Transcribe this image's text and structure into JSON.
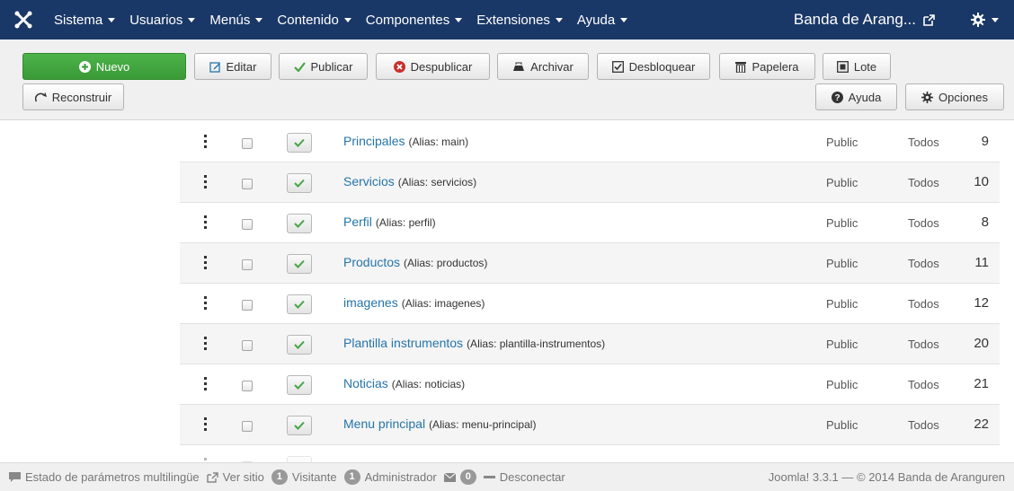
{
  "nav": {
    "menu": [
      {
        "label": "Sistema"
      },
      {
        "label": "Usuarios"
      },
      {
        "label": "Menús"
      },
      {
        "label": "Contenido"
      },
      {
        "label": "Componentes"
      },
      {
        "label": "Extensiones"
      },
      {
        "label": "Ayuda"
      }
    ],
    "site_link": "Banda de Arang...",
    "icons": {
      "logo": "joomla-logo-icon",
      "external": "external-link-icon",
      "gear": "gear-icon"
    }
  },
  "toolbar": {
    "nuevo": "Nuevo",
    "editar": "Editar",
    "publicar": "Publicar",
    "despublicar": "Despublicar",
    "archivar": "Archivar",
    "desbloquear": "Desbloquear",
    "papelera": "Papelera",
    "lote": "Lote",
    "reconstruir": "Reconstruir",
    "ayuda": "Ayuda",
    "opciones": "Opciones"
  },
  "rows": [
    {
      "title": "Principales",
      "alias": "(Alias: main)",
      "access": "Public",
      "language": "Todos",
      "id": "9"
    },
    {
      "title": "Servicios",
      "alias": "(Alias: servicios)",
      "access": "Public",
      "language": "Todos",
      "id": "10"
    },
    {
      "title": "Perfil",
      "alias": "(Alias: perfil)",
      "access": "Public",
      "language": "Todos",
      "id": "8"
    },
    {
      "title": "Productos",
      "alias": "(Alias: productos)",
      "access": "Public",
      "language": "Todos",
      "id": "11"
    },
    {
      "title": "imagenes",
      "alias": "(Alias: imagenes)",
      "access": "Public",
      "language": "Todos",
      "id": "12"
    },
    {
      "title": "Plantilla instrumentos",
      "alias": "(Alias: plantilla-instrumentos)",
      "access": "Public",
      "language": "Todos",
      "id": "20"
    },
    {
      "title": "Noticias",
      "alias": "(Alias: noticias)",
      "access": "Public",
      "language": "Todos",
      "id": "21"
    },
    {
      "title": "Menu principal",
      "alias": "(Alias: menu-principal)",
      "access": "Public",
      "language": "Todos",
      "id": "22"
    }
  ],
  "status": {
    "multilang": "Estado de parámetros multilingüe",
    "ver_sitio": "Ver sitio",
    "visitante_count": "1",
    "visitante": "Visitante",
    "admin_count": "1",
    "administrador": "Administrador",
    "mail_count": "0",
    "desconectar": "Desconectar",
    "copyright": "Joomla! 3.3.1 — © 2014 Banda de Aranguren"
  },
  "colors": {
    "nav_bg": "#1a3867",
    "success": "#3a9a37",
    "link": "#2574a9",
    "publish_check": "#46a546"
  }
}
